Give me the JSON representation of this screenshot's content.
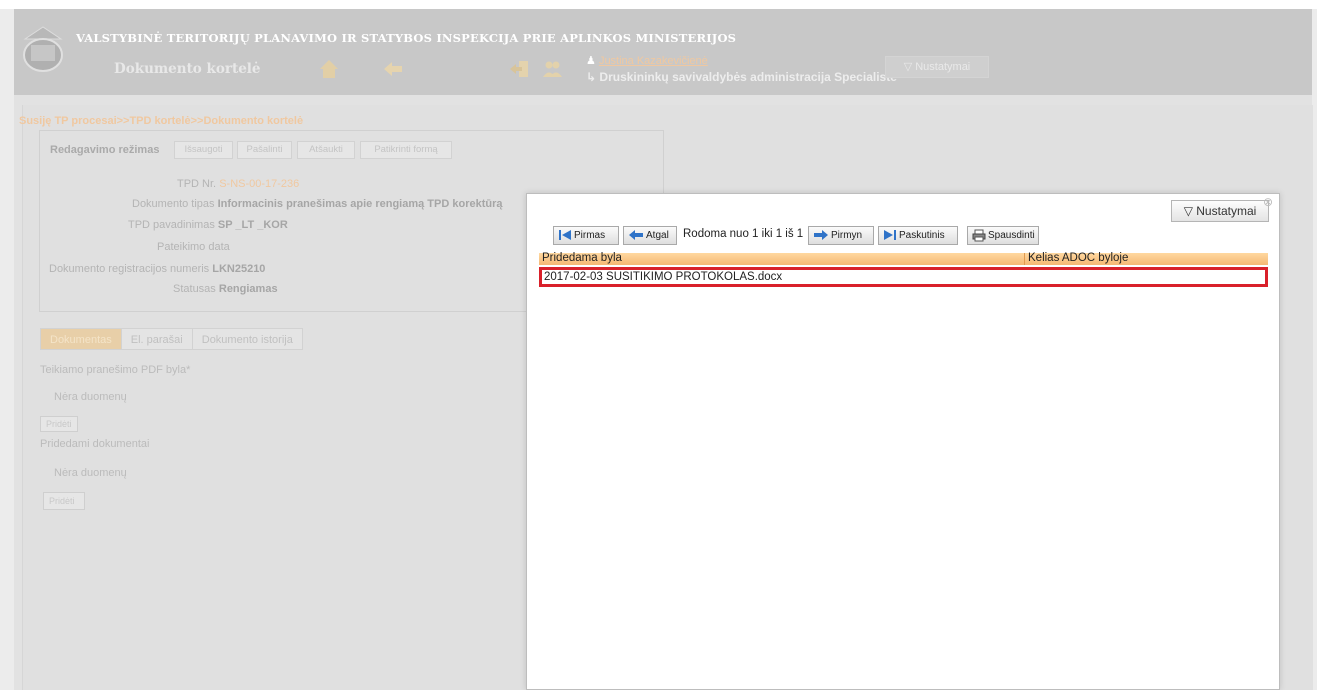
{
  "header": {
    "org_title": "VALSTYBINĖ TERITORIJŲ PLANAVIMO IR STATYBOS INSPEKCIJA PRIE APLINKOS MINISTERIJOS",
    "page_title": "Dokumento kortelė",
    "user_name": "Justina Kazakevičienė",
    "user_role": "Druskininkų savivaldybės administracija Specialistė",
    "settings_label": "▽  Nustatymai"
  },
  "breadcrumb": "Susiję TP procesai>>TPD kortelė>>Dokumento kortelė",
  "edit_mode": {
    "label": "Redagavimo režimas",
    "buttons": [
      "Išsaugoti",
      "Pašalinti",
      "Atšaukti",
      "Patikrinti formą"
    ]
  },
  "form": {
    "tpd_nr_label": "TPD Nr.",
    "tpd_nr_value": "S-NS-00-17-236",
    "doc_type_label": "Dokumento tipas",
    "doc_type_value": "Informacinis pranešimas apie rengiamą TPD korektūrą",
    "tpd_name_label": "TPD pavadinimas",
    "tpd_name_value": "SP _LT _KOR",
    "submit_date_label": "Pateikimo data",
    "submit_date_value": "",
    "reg_nr_label": "Dokumento registracijos numeris",
    "reg_nr_value": "LKN25210",
    "status_label": "Statusas",
    "status_value": "Rengiamas"
  },
  "tabs": [
    "Dokumentas",
    "El. parašai",
    "Dokumento istorija"
  ],
  "sections": {
    "pdf_label": "Teikiamo pranešimo PDF byla*",
    "pdf_empty": "Nėra duomenų",
    "add_label": "Pridėti",
    "attached_label": "Pridedami dokumentai",
    "attached_empty": "Nėra duomenų"
  },
  "dialog": {
    "settings_label": "▽  Nustatymai",
    "pager": {
      "first": "Pirmas",
      "prev": "Atgal",
      "info": "Rodoma nuo 1 iki 1 iš 1",
      "next": "Pirmyn",
      "last": "Paskutinis",
      "print": "Spausdinti"
    },
    "columns": [
      "Pridedama byla",
      "Kelias ADOC byloje"
    ],
    "rows": [
      {
        "file": "2017-02-03 SUSITIKIMO PROTOKOLAS.docx",
        "path": ""
      }
    ]
  },
  "colors": {
    "accent_orange": "#f5b874",
    "highlight_red": "#d9202a",
    "pager_blue": "#2f73c8"
  }
}
